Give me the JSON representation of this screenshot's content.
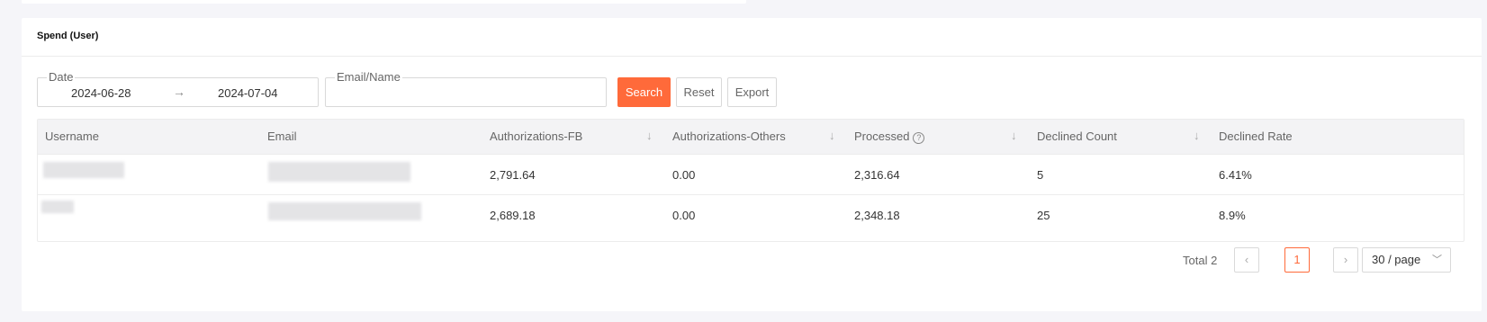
{
  "section": {
    "title": "Spend (User)"
  },
  "filters": {
    "date_label": "Date",
    "date_start": "2024-06-28",
    "date_sep": "→",
    "date_end": "2024-07-04",
    "email_label": "Email/Name",
    "email_value": ""
  },
  "buttons": {
    "search": "Search",
    "reset": "Reset",
    "export": "Export"
  },
  "table": {
    "columns": [
      "Username",
      "Email",
      "Authorizations-FB",
      "Authorizations-Others",
      "Processed",
      "Declined Count",
      "Declined Rate"
    ],
    "sort_icon": "↓",
    "help_icon": "?",
    "rows": [
      {
        "username": "",
        "email": "",
        "auth_fb": "2,791.64",
        "auth_others": "0.00",
        "processed": "2,316.64",
        "declined_count": "5",
        "declined_rate": "6.41%"
      },
      {
        "username": "",
        "email": "",
        "auth_fb": "2,689.18",
        "auth_others": "0.00",
        "processed": "2,348.18",
        "declined_count": "25",
        "declined_rate": "8.9%"
      }
    ]
  },
  "pagination": {
    "total": "Total 2",
    "prev": "‹",
    "current": "1",
    "next": "›",
    "page_size": "30 / page",
    "chevron": "﹀"
  },
  "colors": {
    "accent": "#ff6a3a",
    "header_bg": "#f3f3f5",
    "page_bg": "#f5f5f9"
  }
}
